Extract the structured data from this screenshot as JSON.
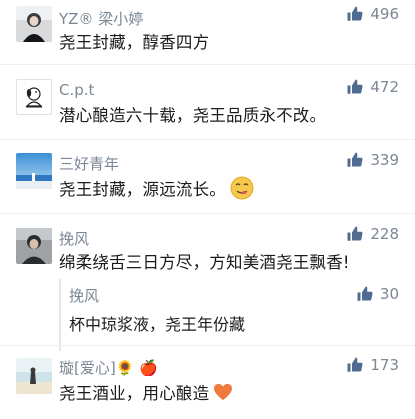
{
  "colors": {
    "meta": "#7b8794",
    "text": "#1b1b1b",
    "like_icon": "#4f6c90",
    "divider": "#efefef"
  },
  "comments": [
    {
      "username": "YZ® 梁小婷",
      "text": "尧王封藏，醇香四方",
      "likes": "496",
      "like_icon": "thumbs-up-icon"
    },
    {
      "username": "C.p.t",
      "text": "潜心酿造六十载，尧王品质永不改。",
      "likes": "472",
      "like_icon": "thumbs-up-icon"
    },
    {
      "username": "三好青年",
      "text": "尧王封藏，源远流长。",
      "emoji": "yum-face",
      "likes": "339",
      "like_icon": "thumbs-up-icon"
    },
    {
      "username": "挽风",
      "text": "绵柔绕舌三日方尽，方知美酒尧王飘香!",
      "likes": "228",
      "like_icon": "thumbs-up-icon",
      "reply": {
        "username": "挽风",
        "text": "杯中琼浆液，尧王年份藏",
        "likes": "30"
      }
    },
    {
      "username": "璇[爱心]🌻 🍎",
      "text": "尧王酒业，用心酿造",
      "emoji": "heart",
      "likes": "173",
      "like_icon": "thumbs-up-icon"
    }
  ]
}
